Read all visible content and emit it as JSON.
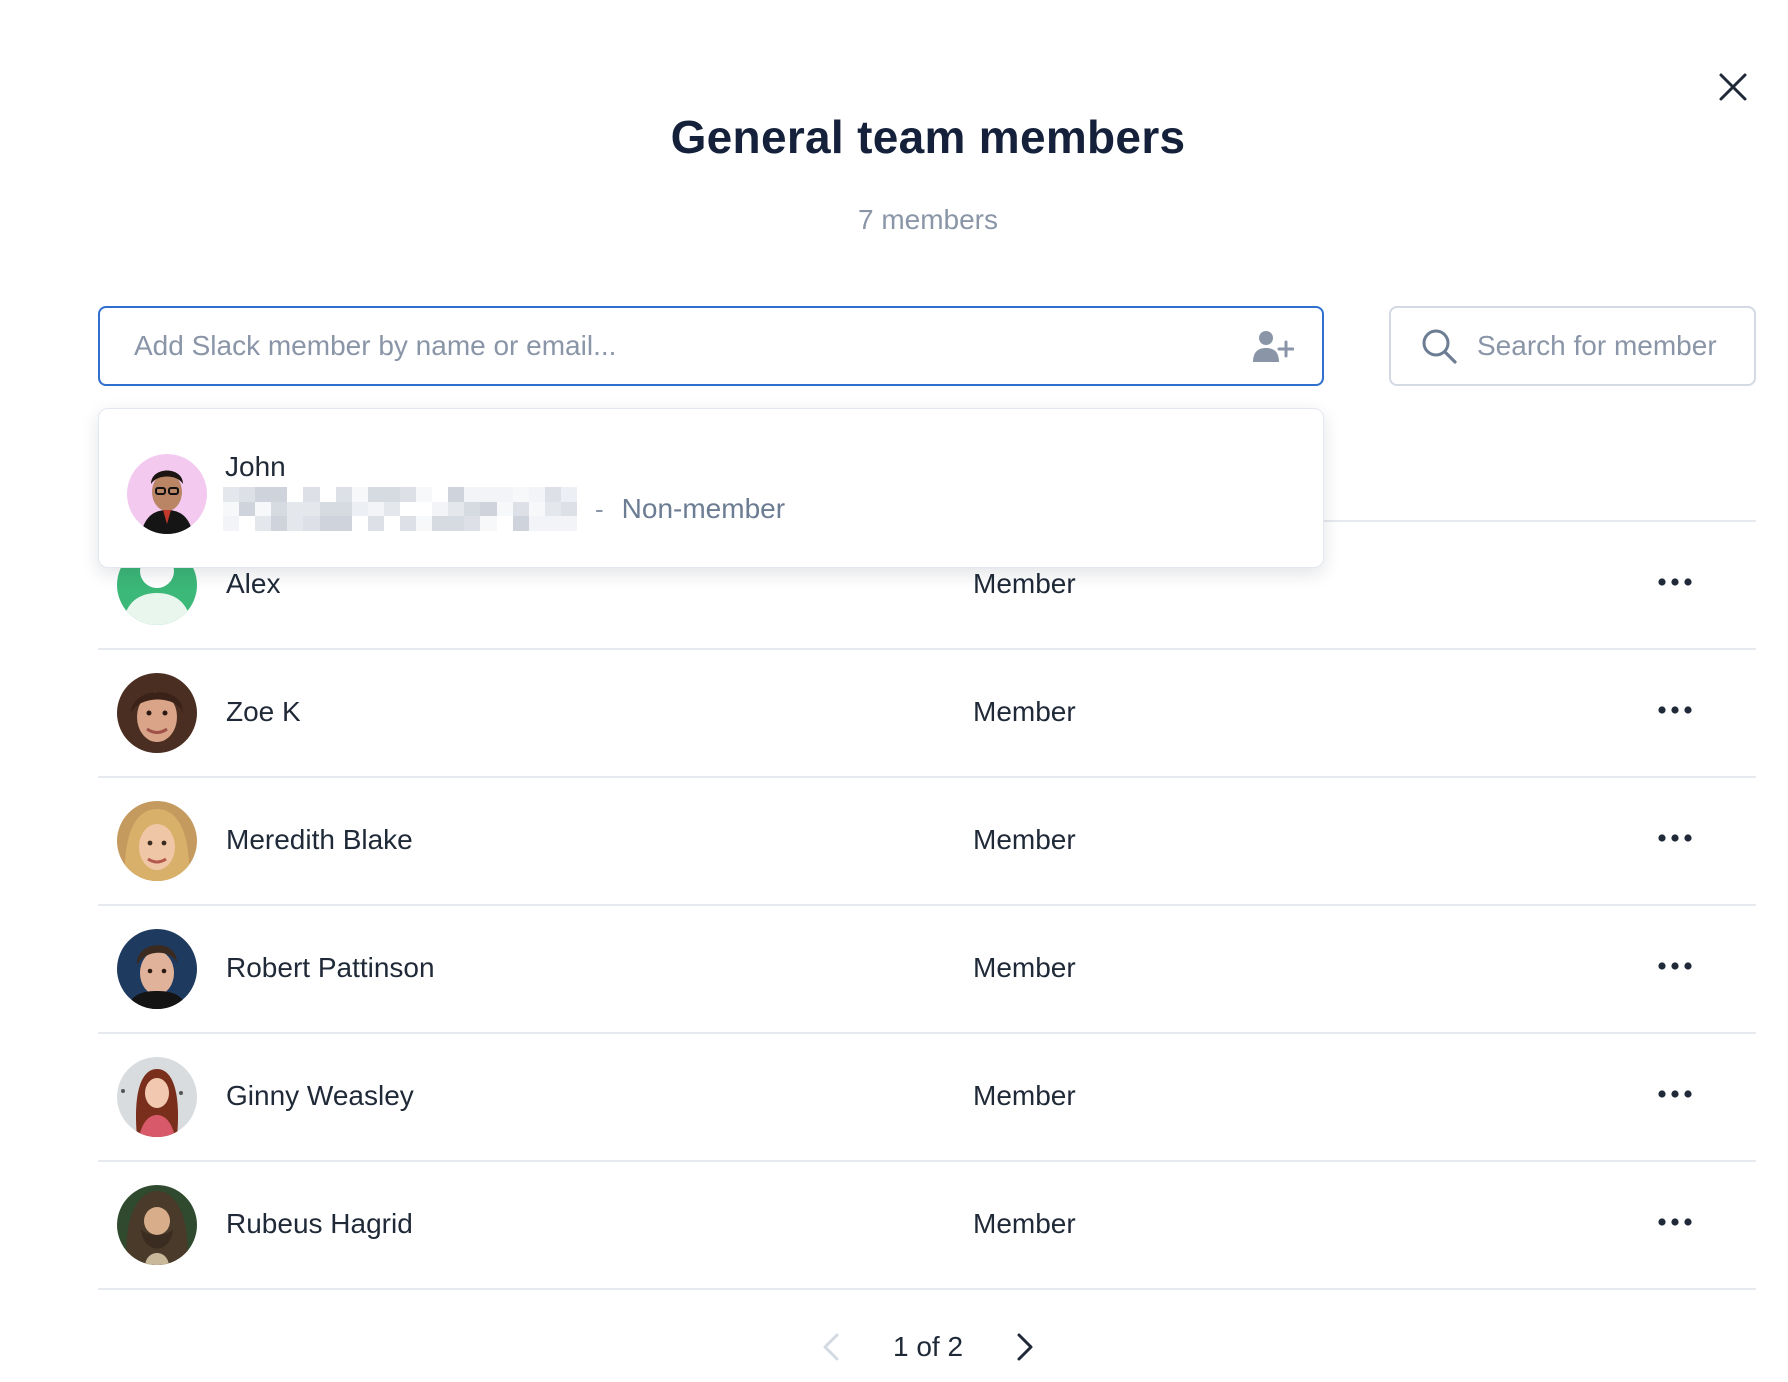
{
  "modal": {
    "title": "General team members",
    "member_count": "7 members"
  },
  "add_member": {
    "placeholder": "Add Slack member by name or email...",
    "value": ""
  },
  "search": {
    "placeholder": "Search for member"
  },
  "suggestion": {
    "name": "John",
    "separator": "-",
    "status": "Non-member"
  },
  "members": [
    {
      "name": "Alex",
      "role": "Member",
      "avatar": "default-user-avatar"
    },
    {
      "name": "Zoe K",
      "role": "Member",
      "avatar": "photo-avatar"
    },
    {
      "name": "Meredith Blake",
      "role": "Member",
      "avatar": "photo-avatar"
    },
    {
      "name": "Robert Pattinson",
      "role": "Member",
      "avatar": "photo-avatar"
    },
    {
      "name": "Ginny Weasley",
      "role": "Member",
      "avatar": "photo-avatar"
    },
    {
      "name": "Rubeus Hagrid",
      "role": "Member",
      "avatar": "photo-avatar"
    }
  ],
  "pagination": {
    "label": "1 of 2",
    "current_page": 1,
    "total_pages": 2
  },
  "colors": {
    "focus_border": "#2f6fce",
    "title": "#15213b",
    "muted": "#8a96a8",
    "divider": "#e6e9ee",
    "alex_avatar": "#3cb878"
  },
  "icons": {
    "close": "close-icon",
    "add_user": "add-user-icon",
    "search": "search-icon",
    "more": "more-horizontal-icon",
    "prev": "chevron-left-icon",
    "next": "chevron-right-icon"
  }
}
